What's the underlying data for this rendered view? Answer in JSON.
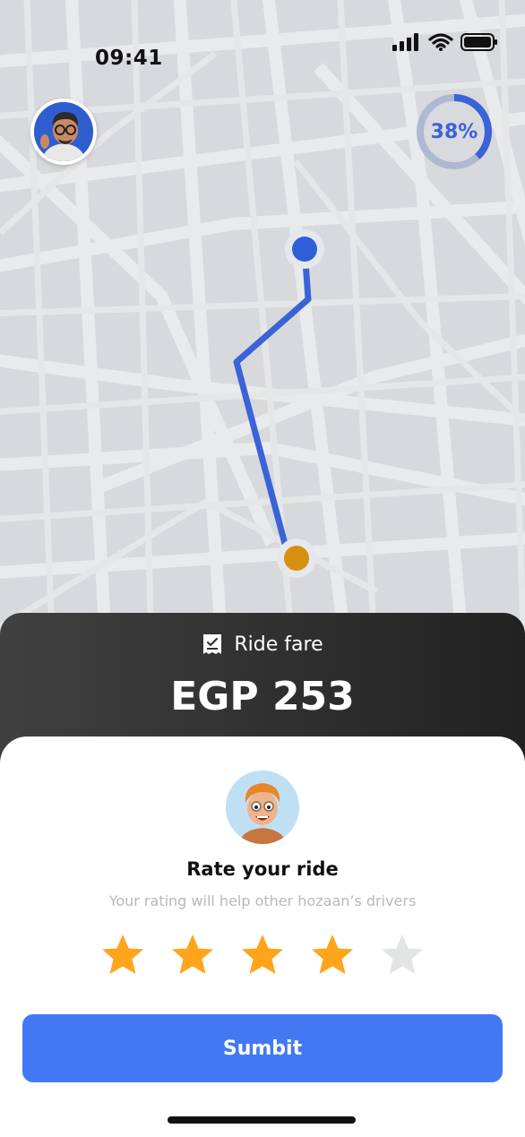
{
  "status_bar": {
    "time": "09:41",
    "icons": [
      "signal-icon",
      "wifi-icon",
      "battery-icon"
    ]
  },
  "profile": {
    "avatar": "user-avatar"
  },
  "trip_progress": {
    "percent": 38,
    "label": "38%"
  },
  "map": {
    "pickup_marker_color": "#2f5fd8",
    "dropoff_marker_color": "#d78f12",
    "route_color": "#3a63d8"
  },
  "fare": {
    "icon": "receipt-icon",
    "label": "Ride fare",
    "amount": "EGP 253"
  },
  "rating": {
    "driver_avatar": "driver-avatar",
    "title": "Rate your ride",
    "subtitle": "Your rating will help other hozaan’s drivers",
    "value": 4,
    "max": 5,
    "filled_color": "#ffa41b",
    "empty_color": "#e2e4e7"
  },
  "actions": {
    "submit_label": "Sumbit"
  },
  "colors": {
    "accent": "#4378f5"
  }
}
